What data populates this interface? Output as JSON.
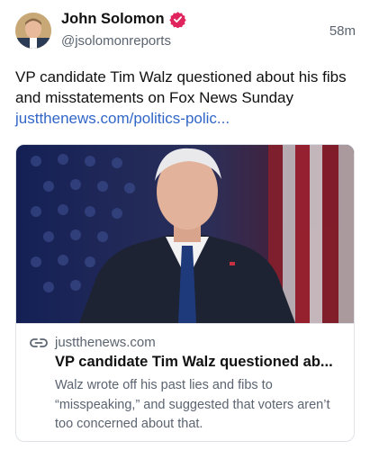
{
  "author": {
    "display_name": "John Solomon",
    "handle": "@jsolomonreports",
    "verified": true,
    "verified_color": "#e0245e"
  },
  "post": {
    "timestamp": "58m",
    "text": "VP candidate Tim Walz questioned about his fibs and misstatements on Fox News Sunday",
    "link_text": "justthenews.com/politics-polic...",
    "link_color": "#3166c7"
  },
  "link_card": {
    "domain": "justthenews.com",
    "title": "VP candidate Tim Walz questioned ab...",
    "description": "Walz wrote off his past lies and fibs to “misspeaking,” and suggested that voters aren’t too concerned about that.",
    "icon": "link-icon"
  }
}
